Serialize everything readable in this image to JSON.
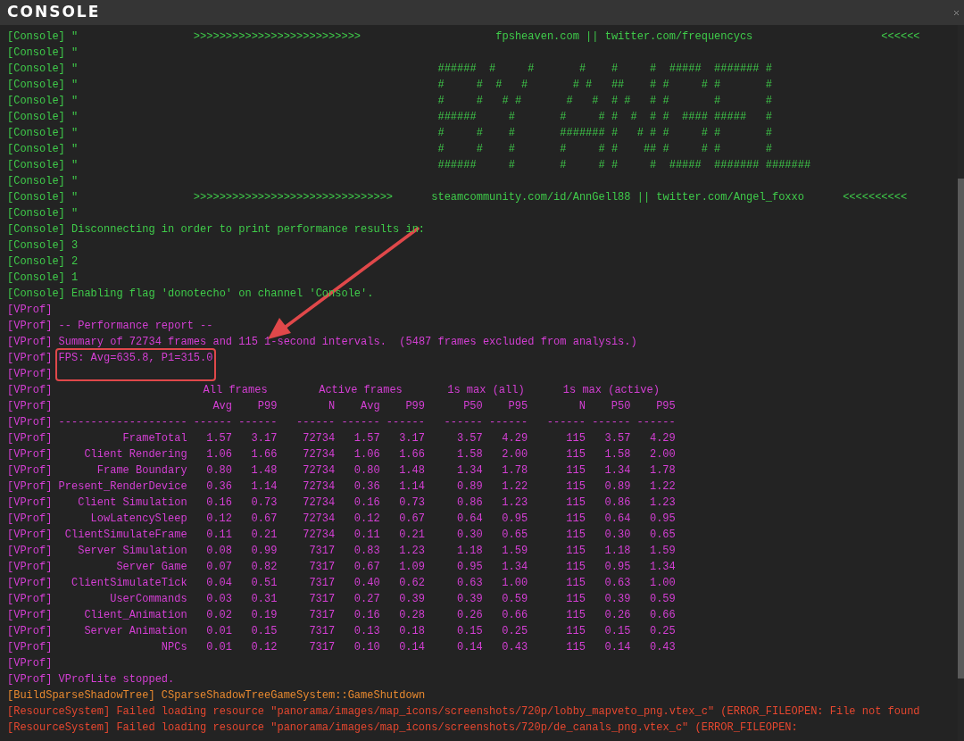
{
  "window": {
    "title": "CONSOLE"
  },
  "lines_before": [
    {
      "kind": "console",
      "tag": "[Console]",
      "text": "\"                  >>>>>>>>>>>>>>>>>>>>>>>>>>                     fpsheaven.com || twitter.com/frequencycs                    <<<<<<",
      "highlighted": false
    },
    {
      "kind": "console",
      "tag": "[Console]",
      "text": "\"",
      "highlighted": false
    },
    {
      "kind": "console",
      "tag": "[Console]",
      "text": "\"                                                        ######  #     #       #    #     #  #####  ####### #",
      "highlighted": false
    },
    {
      "kind": "console",
      "tag": "[Console]",
      "text": "\"                                                        #     #  #   #       # #   ##    # #     # #       #",
      "highlighted": false
    },
    {
      "kind": "console",
      "tag": "[Console]",
      "text": "\"                                                        #     #   # #       #   #  # #   # #       #       #",
      "highlighted": false
    },
    {
      "kind": "console",
      "tag": "[Console]",
      "text": "\"                                                        ######     #       #     # #  #  # #  #### #####   #",
      "highlighted": false
    },
    {
      "kind": "console",
      "tag": "[Console]",
      "text": "\"                                                        #     #    #       ####### #   # # #     # #       #",
      "highlighted": false
    },
    {
      "kind": "console",
      "tag": "[Console]",
      "text": "\"                                                        #     #    #       #     # #    ## #     # #       #",
      "highlighted": false
    },
    {
      "kind": "console",
      "tag": "[Console]",
      "text": "\"                                                        ######     #       #     # #     #  #####  ####### #######",
      "highlighted": false
    },
    {
      "kind": "console",
      "tag": "[Console]",
      "text": "\"",
      "highlighted": false
    },
    {
      "kind": "console",
      "tag": "[Console]",
      "text": "\"                  >>>>>>>>>>>>>>>>>>>>>>>>>>>>>>>      steamcommunity.com/id/AnnGell88 || twitter.com/Angel_foxxo      <<<<<<<<<<",
      "highlighted": false
    },
    {
      "kind": "console",
      "tag": "[Console]",
      "text": "\"",
      "highlighted": false
    },
    {
      "kind": "console",
      "tag": "[Console]",
      "text": "Disconnecting in order to print performance results in:",
      "highlighted": false
    },
    {
      "kind": "console",
      "tag": "[Console]",
      "text": "3",
      "highlighted": false
    },
    {
      "kind": "console",
      "tag": "[Console]",
      "text": "2",
      "highlighted": false
    },
    {
      "kind": "console",
      "tag": "[Console]",
      "text": "1",
      "highlighted": false
    },
    {
      "kind": "console",
      "tag": "[Console]",
      "text": "Enabling flag 'donotecho' on channel 'Console'.",
      "highlighted": false
    },
    {
      "kind": "vprof",
      "tag": "[VProf]",
      "highlighted": false
    },
    {
      "kind": "vprof",
      "tag": "[VProf]",
      "text": "-- Performance report --",
      "highlighted": false
    },
    {
      "kind": "vprof",
      "tag": "[VProf]",
      "text": "Summary of 72734 frames and 115 1-second intervals.  (5487 frames excluded from analysis.)",
      "highlighted": false
    },
    {
      "kind": "vprof",
      "tag": "[VProf]",
      "text": "FPS: Avg=635.8, P1=315.0",
      "highlighted": true
    },
    {
      "kind": "vprof",
      "tag": "[VProf]",
      "highlighted": false
    }
  ],
  "table": {
    "kind": "vprof",
    "group_row": {
      "tag": "[VProf]",
      "labels": [
        "All frames",
        "Active frames",
        "1s max (all)",
        "1s max (active)"
      ]
    },
    "column_row": {
      "tag": "[VProf]",
      "groups": [
        [
          "Avg",
          "P99"
        ],
        [
          "N",
          "Avg",
          "P99"
        ],
        [
          "P50",
          "P95"
        ],
        [
          "N",
          "P50",
          "P95"
        ]
      ]
    },
    "rows": [
      {
        "tag": "[VProf]",
        "name": "--------------------",
        "values": [
          "------",
          "------",
          "------",
          "------",
          "------",
          "------",
          "------",
          "------",
          "------",
          "------"
        ]
      },
      {
        "tag": "[VProf]",
        "name": "FrameTotal",
        "values": [
          "1.57",
          "3.17",
          "72734",
          "1.57",
          "3.17",
          "3.57",
          "4.29",
          "115",
          "3.57",
          "4.29"
        ]
      },
      {
        "tag": "[VProf]",
        "name": "Client Rendering",
        "values": [
          "1.06",
          "1.66",
          "72734",
          "1.06",
          "1.66",
          "1.58",
          "2.00",
          "115",
          "1.58",
          "2.00"
        ]
      },
      {
        "tag": "[VProf]",
        "name": "Frame Boundary",
        "values": [
          "0.80",
          "1.48",
          "72734",
          "0.80",
          "1.48",
          "1.34",
          "1.78",
          "115",
          "1.34",
          "1.78"
        ]
      },
      {
        "tag": "[VProf]",
        "name": "Present_RenderDevice",
        "values": [
          "0.36",
          "1.14",
          "72734",
          "0.36",
          "1.14",
          "0.89",
          "1.22",
          "115",
          "0.89",
          "1.22"
        ]
      },
      {
        "tag": "[VProf]",
        "name": "Client Simulation",
        "values": [
          "0.16",
          "0.73",
          "72734",
          "0.16",
          "0.73",
          "0.86",
          "1.23",
          "115",
          "0.86",
          "1.23"
        ]
      },
      {
        "tag": "[VProf]",
        "name": "LowLatencySleep",
        "values": [
          "0.12",
          "0.67",
          "72734",
          "0.12",
          "0.67",
          "0.64",
          "0.95",
          "115",
          "0.64",
          "0.95"
        ]
      },
      {
        "tag": "[VProf]",
        "name": "ClientSimulateFrame",
        "values": [
          "0.11",
          "0.21",
          "72734",
          "0.11",
          "0.21",
          "0.30",
          "0.65",
          "115",
          "0.30",
          "0.65"
        ]
      },
      {
        "tag": "[VProf]",
        "name": "Server Simulation",
        "values": [
          "0.08",
          "0.99",
          "7317",
          "0.83",
          "1.23",
          "1.18",
          "1.59",
          "115",
          "1.18",
          "1.59"
        ]
      },
      {
        "tag": "[VProf]",
        "name": "Server Game",
        "values": [
          "0.07",
          "0.82",
          "7317",
          "0.67",
          "1.09",
          "0.95",
          "1.34",
          "115",
          "0.95",
          "1.34"
        ]
      },
      {
        "tag": "[VProf]",
        "name": "ClientSimulateTick",
        "values": [
          "0.04",
          "0.51",
          "7317",
          "0.40",
          "0.62",
          "0.63",
          "1.00",
          "115",
          "0.63",
          "1.00"
        ]
      },
      {
        "tag": "[VProf]",
        "name": "UserCommands",
        "values": [
          "0.03",
          "0.31",
          "7317",
          "0.27",
          "0.39",
          "0.39",
          "0.59",
          "115",
          "0.39",
          "0.59"
        ]
      },
      {
        "tag": "[VProf]",
        "name": "Client_Animation",
        "values": [
          "0.02",
          "0.19",
          "7317",
          "0.16",
          "0.28",
          "0.26",
          "0.66",
          "115",
          "0.26",
          "0.66"
        ]
      },
      {
        "tag": "[VProf]",
        "name": "Server Animation",
        "values": [
          "0.01",
          "0.15",
          "7317",
          "0.13",
          "0.18",
          "0.15",
          "0.25",
          "115",
          "0.15",
          "0.25"
        ]
      },
      {
        "tag": "[VProf]",
        "name": "NPCs",
        "values": [
          "0.01",
          "0.12",
          "7317",
          "0.10",
          "0.14",
          "0.14",
          "0.43",
          "115",
          "0.14",
          "0.43"
        ]
      }
    ]
  },
  "lines_after": [
    {
      "kind": "vprof",
      "tag": "[VProf]",
      "highlighted": false
    },
    {
      "kind": "vprof",
      "tag": "[VProf]",
      "text": "VProfLite stopped.",
      "highlighted": false
    },
    {
      "kind": "build",
      "tag": "[BuildSparseShadowTree]",
      "text": "CSparseShadowTreeGameSystem::GameShutdown",
      "highlighted": false
    },
    {
      "kind": "resource",
      "tag": "[ResourceSystem]",
      "text": "Failed loading resource \"panorama/images/map_icons/screenshots/720p/lobby_mapveto_png.vtex_c\" (ERROR_FILEOPEN: File not found",
      "highlighted": false
    },
    {
      "kind": "resource",
      "tag": "[ResourceSystem]",
      "text": "Failed loading resource \"panorama/images/map_icons/screenshots/720p/de_canals_png.vtex_c\" (ERROR_FILEOPEN:",
      "highlighted": false
    }
  ]
}
